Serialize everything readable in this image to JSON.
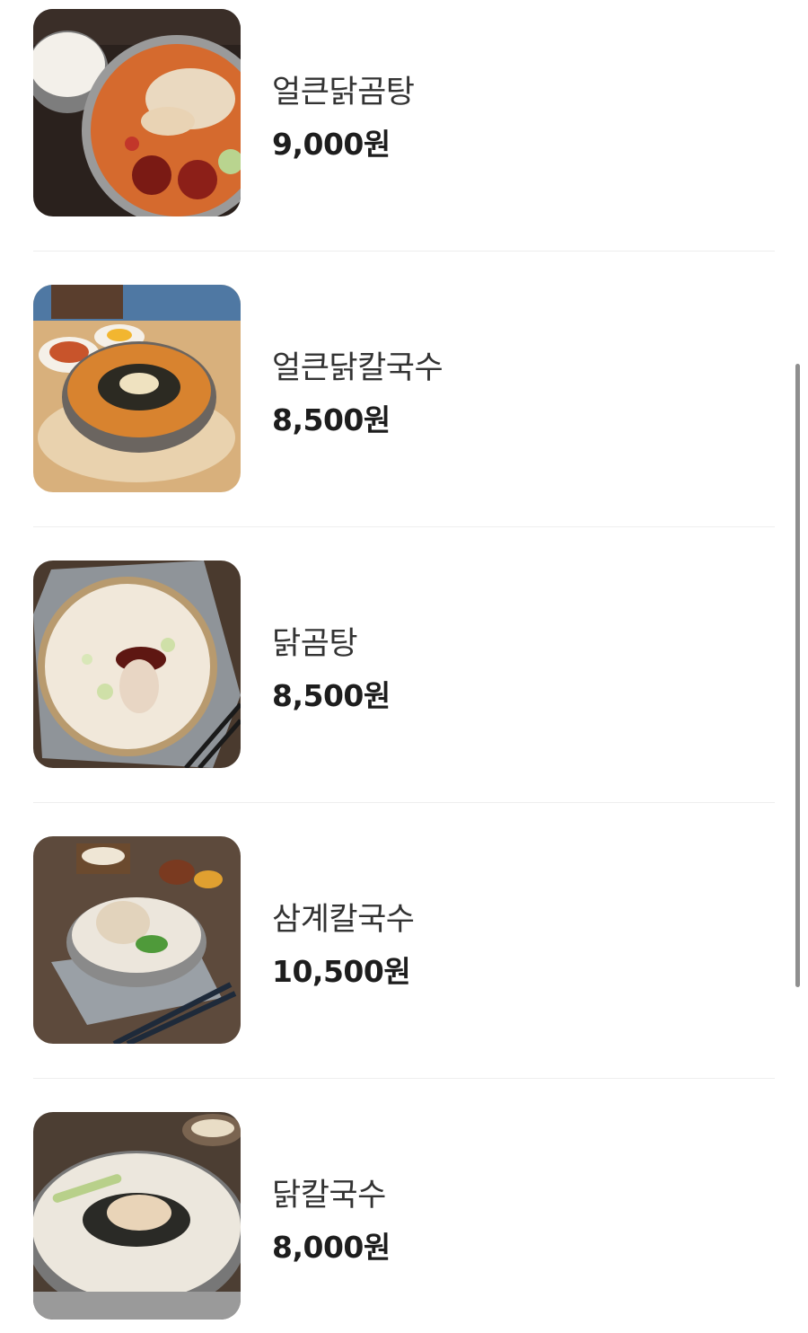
{
  "menu": {
    "items": [
      {
        "name": "얼큰닭곰탕",
        "price": "9,000원",
        "image": "spicy-chicken-soup-photo"
      },
      {
        "name": "얼큰닭칼국수",
        "price": "8,500원",
        "image": "spicy-chicken-noodle-photo"
      },
      {
        "name": "닭곰탕",
        "price": "8,500원",
        "image": "chicken-soup-photo"
      },
      {
        "name": "삼계칼국수",
        "price": "10,500원",
        "image": "samgye-noodle-photo"
      },
      {
        "name": "닭칼국수",
        "price": "8,000원",
        "image": "chicken-noodle-photo"
      }
    ]
  },
  "colors": {
    "divider": "#eeeeee",
    "name_text": "#333333",
    "price_text": "#1d1d1d",
    "scrollbar": "#8f8f8f"
  }
}
